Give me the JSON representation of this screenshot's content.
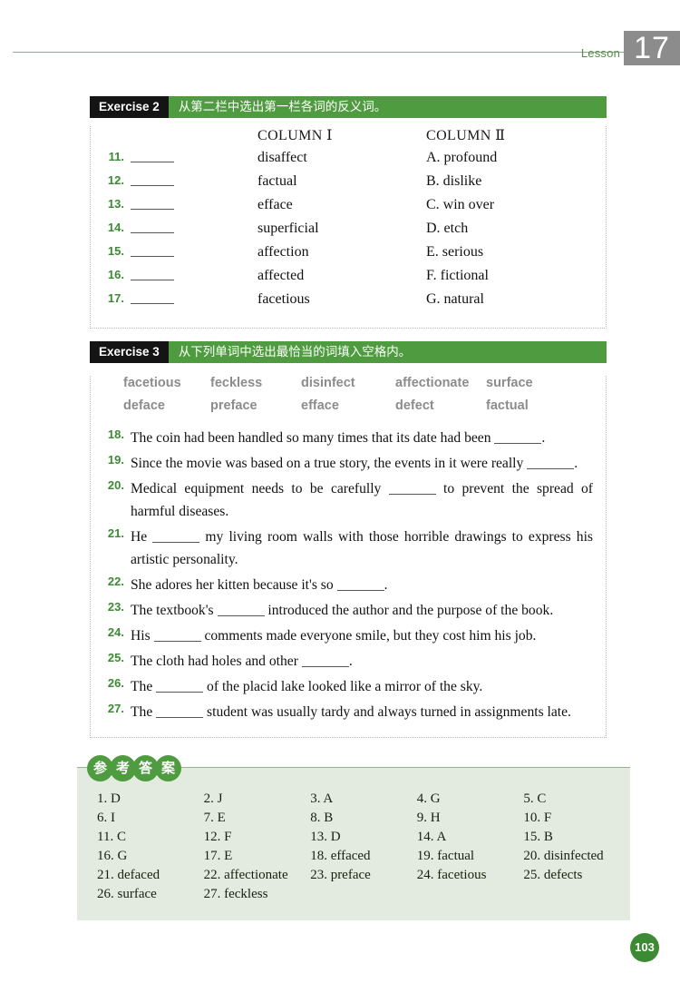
{
  "header": {
    "lesson_label": "Lesson",
    "lesson_number": "17"
  },
  "exercise2": {
    "tag": "Exercise 2",
    "title": "从第二栏中选出第一栏各词的反义词。",
    "column1_header": "COLUMN Ⅰ",
    "column2_header": "COLUMN Ⅱ",
    "rows": [
      {
        "num": "11.",
        "word": "disaffect",
        "option": "A. profound"
      },
      {
        "num": "12.",
        "word": "factual",
        "option": "B. dislike"
      },
      {
        "num": "13.",
        "word": "efface",
        "option": "C. win over"
      },
      {
        "num": "14.",
        "word": "superficial",
        "option": "D. etch"
      },
      {
        "num": "15.",
        "word": "affection",
        "option": "E. serious"
      },
      {
        "num": "16.",
        "word": "affected",
        "option": "F. fictional"
      },
      {
        "num": "17.",
        "word": "facetious",
        "option": "G. natural"
      }
    ]
  },
  "exercise3": {
    "tag": "Exercise 3",
    "title": "从下列单词中选出最恰当的词填入空格内。",
    "wordbank_row1": [
      "facetious",
      "feckless",
      "disinfect",
      "affectionate",
      "surface"
    ],
    "wordbank_row2": [
      "deface",
      "preface",
      "efface",
      "defect",
      "factual"
    ],
    "questions": [
      {
        "num": "18.",
        "pre": "The coin had been handled so many times that its date had been ",
        "post": "."
      },
      {
        "num": "19.",
        "pre": "Since the movie was based on a true story, the events in it were really ",
        "post": "."
      },
      {
        "num": "20.",
        "pre": "Medical equipment needs to be carefully ",
        "post": " to prevent the spread of harmful diseases."
      },
      {
        "num": "21.",
        "pre": "He ",
        "post": " my living room walls with those horrible drawings to express his artistic personality."
      },
      {
        "num": "22.",
        "pre": "She adores her kitten because it's so ",
        "post": "."
      },
      {
        "num": "23.",
        "pre": "The textbook's ",
        "post": " introduced the author and the purpose of the book."
      },
      {
        "num": "24.",
        "pre": "His ",
        "post": " comments made everyone smile, but they cost him his job."
      },
      {
        "num": "25.",
        "pre": "The cloth had holes and other ",
        "post": "."
      },
      {
        "num": "26.",
        "pre": "The ",
        "post": " of the placid lake looked like a mirror of the sky."
      },
      {
        "num": "27.",
        "pre": "The ",
        "post": " student was usually tardy and always turned in assignments late."
      }
    ]
  },
  "answer_key": {
    "label_chars": [
      "参",
      "考",
      "答",
      "案"
    ],
    "rows": [
      [
        "1. D",
        "2. J",
        "3. A",
        "4. G",
        "5. C"
      ],
      [
        "6. I",
        "7. E",
        "8. B",
        "9. H",
        "10. F"
      ],
      [
        "11. C",
        "12. F",
        "13. D",
        "14. A",
        "15. B"
      ],
      [
        "16. G",
        "17. E",
        "18. effaced",
        "19. factual",
        "20. disinfected"
      ],
      [
        "21. defaced",
        "22. affectionate",
        "23. preface",
        "24. facetious",
        "25. defects"
      ],
      [
        "26. surface",
        "27. feckless",
        "",
        "",
        ""
      ]
    ]
  },
  "footer": {
    "page_number": "103"
  },
  "colors": {
    "green_band": "#4e9c3f",
    "green_number": "#3c8a33",
    "gray_box": "#8c8c8c",
    "answer_bg": "#e3eae0"
  }
}
